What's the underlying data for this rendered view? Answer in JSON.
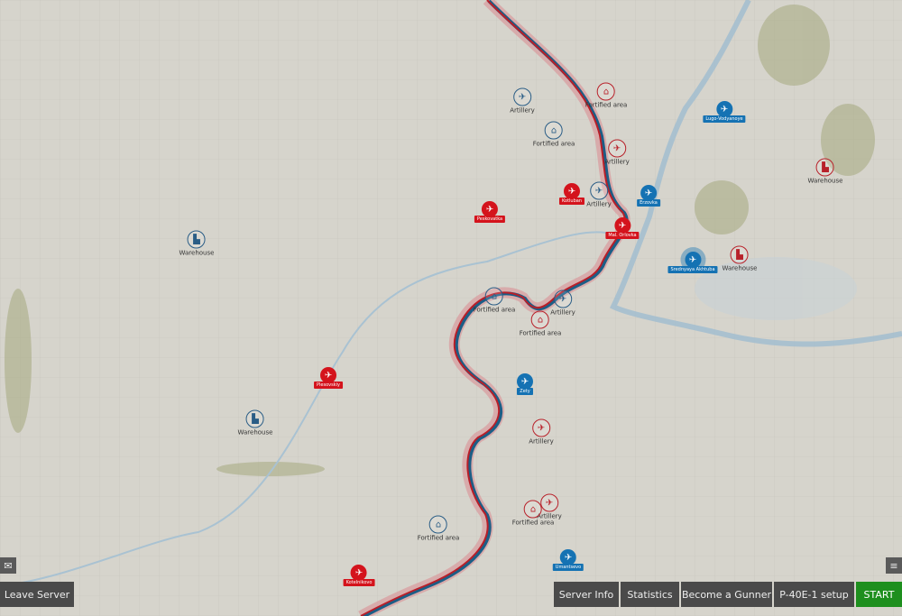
{
  "colors": {
    "red": "#d4131c",
    "blue": "#1572b3",
    "start": "#1e8f1e",
    "button": "#4a4a4a",
    "map": "#d6d4cc"
  },
  "objectives": [
    {
      "side": "red",
      "type": "fortified",
      "label": "Fortified area"
    },
    {
      "side": "red",
      "type": "artillery",
      "label": "Artillery"
    },
    {
      "side": "red",
      "type": "fortified",
      "label": "Fortified area"
    },
    {
      "side": "red",
      "type": "artillery",
      "label": "Artillery"
    },
    {
      "side": "red",
      "type": "artillery",
      "label": "Artillery"
    },
    {
      "side": "red",
      "type": "fortified",
      "label": "Fortified area"
    },
    {
      "side": "red",
      "type": "warehouse",
      "label": "Warehouse"
    },
    {
      "side": "red",
      "type": "warehouse",
      "label": "Warehouse"
    },
    {
      "side": "blue",
      "type": "artillery",
      "label": "Artillery"
    },
    {
      "side": "blue",
      "type": "fortified",
      "label": "Fortified area"
    },
    {
      "side": "blue",
      "type": "artillery",
      "label": "Artillery"
    },
    {
      "side": "blue",
      "type": "fortified",
      "label": "Fortified area"
    },
    {
      "side": "blue",
      "type": "artillery",
      "label": "Artillery"
    },
    {
      "side": "blue",
      "type": "warehouse",
      "label": "Warehouse"
    },
    {
      "side": "blue",
      "type": "warehouse",
      "label": "Warehouse"
    },
    {
      "side": "blue",
      "type": "fortified",
      "label": "Fortified area"
    }
  ],
  "airfields": [
    {
      "side": "red",
      "label": "Peskovatka"
    },
    {
      "side": "red",
      "label": "Kotluban"
    },
    {
      "side": "red",
      "label": "Mal. Orlovka"
    },
    {
      "side": "red",
      "label": "Plesovskiy"
    },
    {
      "side": "red",
      "label": "Kotelnikovo"
    },
    {
      "side": "blue",
      "label": "Erzovka"
    },
    {
      "side": "blue",
      "label": "Lugo-Vodyanoye"
    },
    {
      "side": "blue",
      "label": "Srednyaya Akhtuba",
      "selected": true
    },
    {
      "side": "blue",
      "label": "Zety"
    },
    {
      "side": "blue",
      "label": "Umantsevo"
    }
  ],
  "buttons": {
    "leave": "Leave Server",
    "server_info": "Server Info",
    "statistics": "Statistics",
    "gunner": "Become a Gunner",
    "setup": "P-40E-1 setup",
    "start": "START"
  },
  "icons": {
    "chat": "chat-icon",
    "list": "list-icon",
    "artillery": "cannon-icon",
    "fortified": "bunker-icon",
    "warehouse": "factory-icon",
    "airfield": "plane-icon"
  }
}
